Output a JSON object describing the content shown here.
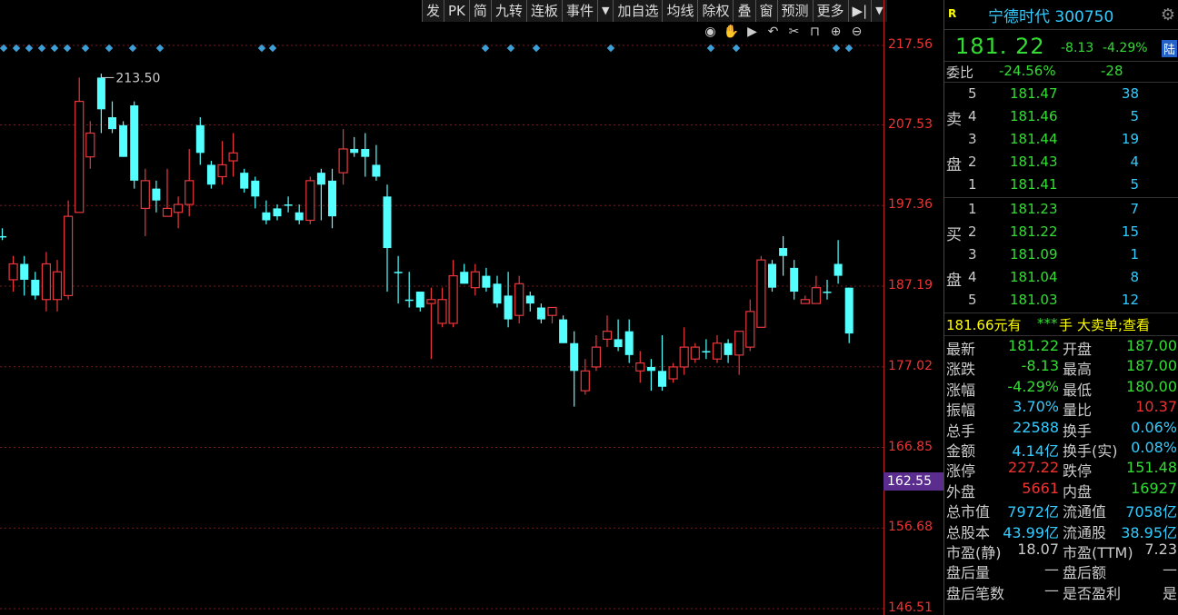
{
  "toolbar": {
    "items": [
      "发",
      "PK",
      "简",
      "九转",
      "连板",
      "事件",
      "▼",
      "加自选",
      "均线",
      "除权",
      "叠",
      "窗",
      "预测",
      "更多",
      "▶|",
      "▼"
    ]
  },
  "chart_controls": {
    "icons": [
      "eye-icon",
      "hand-icon",
      "play-icon",
      "undo-icon",
      "scissors-icon",
      "lock-icon",
      "zoom-in-icon",
      "zoom-out-icon"
    ]
  },
  "chart_data": {
    "type": "candlestick",
    "price_axis_labels": [
      "217.56",
      "207.53",
      "197.36",
      "187.19",
      "177.02",
      "166.85",
      "156.68",
      "146.51"
    ],
    "ylim": [
      146.51,
      222.0
    ],
    "current_price_tag": "162.55",
    "max_annotation": "213.50",
    "candles": [
      [
        193.5,
        193.5,
        194.5,
        193.0
      ],
      [
        188.0,
        190.0,
        191.0,
        186.5
      ],
      [
        190.0,
        188.0,
        191.0,
        186.0
      ],
      [
        188.0,
        186.0,
        189.0,
        185.5
      ],
      [
        185.5,
        190.0,
        191.5,
        184.0
      ],
      [
        185.5,
        189.0,
        190.5,
        184.0
      ],
      [
        186.0,
        196.0,
        198.0,
        185.5
      ],
      [
        196.5,
        210.5,
        213.5,
        202.0
      ],
      [
        203.5,
        206.5,
        208.0,
        202.0
      ],
      [
        213.5,
        209.5,
        214.0,
        206.5
      ],
      [
        208.5,
        207.0,
        210.5,
        206.5
      ],
      [
        207.5,
        203.5,
        208.0,
        203.5
      ],
      [
        210.0,
        200.5,
        210.5,
        199.5
      ],
      [
        197.0,
        200.5,
        202.0,
        193.5
      ],
      [
        199.5,
        198.0,
        200.5,
        196.5
      ],
      [
        196.0,
        197.0,
        202.0,
        196.0
      ],
      [
        196.5,
        197.5,
        198.5,
        194.5
      ],
      [
        197.5,
        200.5,
        204.5,
        196.0
      ],
      [
        207.5,
        204.0,
        208.5,
        202.5
      ],
      [
        202.5,
        200.0,
        203.0,
        199.5
      ],
      [
        201.0,
        202.5,
        205.5,
        200.0
      ],
      [
        203.0,
        204.0,
        206.5,
        201.0
      ],
      [
        201.5,
        199.5,
        202.0,
        199.0
      ],
      [
        200.5,
        198.5,
        201.0,
        197.0
      ],
      [
        196.5,
        195.5,
        198.0,
        195.0
      ],
      [
        197.0,
        196.0,
        197.5,
        195.5
      ],
      [
        197.5,
        197.5,
        198.5,
        196.5
      ],
      [
        196.5,
        195.5,
        197.5,
        195.0
      ],
      [
        195.5,
        200.5,
        201.0,
        195.0
      ],
      [
        201.5,
        200.0,
        202.0,
        195.5
      ],
      [
        200.5,
        196.0,
        202.0,
        194.5
      ],
      [
        201.5,
        204.5,
        207.0,
        200.0
      ],
      [
        204.5,
        204.0,
        206.0,
        203.5
      ],
      [
        204.5,
        203.5,
        206.5,
        201.0
      ],
      [
        202.5,
        201.0,
        205.0,
        200.5
      ],
      [
        198.5,
        192.0,
        200.0,
        186.5
      ],
      [
        189.0,
        189.0,
        191.0,
        185.0
      ],
      [
        185.5,
        185.5,
        189.0,
        184.5
      ],
      [
        186.5,
        184.5,
        186.5,
        184.0
      ],
      [
        185.0,
        185.5,
        187.0,
        178.0
      ],
      [
        182.5,
        185.5,
        187.0,
        182.0
      ],
      [
        182.5,
        188.5,
        190.5,
        182.0
      ],
      [
        189.0,
        187.5,
        190.0,
        187.5
      ],
      [
        187.0,
        189.0,
        190.0,
        186.0
      ],
      [
        188.5,
        187.0,
        189.5,
        186.5
      ],
      [
        187.5,
        185.0,
        188.5,
        184.5
      ],
      [
        186.0,
        183.0,
        189.0,
        182.0
      ],
      [
        183.5,
        187.5,
        188.5,
        182.5
      ],
      [
        186.0,
        185.0,
        186.5,
        184.0
      ],
      [
        184.5,
        183.0,
        185.0,
        182.5
      ],
      [
        183.5,
        184.5,
        184.5,
        182.5
      ],
      [
        183.0,
        180.0,
        183.5,
        180.0
      ],
      [
        180.0,
        176.5,
        181.5,
        172.0
      ],
      [
        174.0,
        176.5,
        178.0,
        173.5
      ],
      [
        177.0,
        179.5,
        181.0,
        176.5
      ],
      [
        180.5,
        181.5,
        183.5,
        179.5
      ],
      [
        180.5,
        179.5,
        183.0,
        179.0
      ],
      [
        181.5,
        178.5,
        183.0,
        177.5
      ],
      [
        176.5,
        177.5,
        179.0,
        175.0
      ],
      [
        177.0,
        176.5,
        178.0,
        174.0
      ],
      [
        176.5,
        174.5,
        181.0,
        174.0
      ],
      [
        175.5,
        177.0,
        177.5,
        175.0
      ],
      [
        177.0,
        179.5,
        182.0,
        176.0
      ],
      [
        178.0,
        179.5,
        180.0,
        177.5
      ],
      [
        179.0,
        179.0,
        180.5,
        178.0
      ],
      [
        178.0,
        180.0,
        181.0,
        177.5
      ],
      [
        180.0,
        178.5,
        180.5,
        177.5
      ],
      [
        178.5,
        181.5,
        181.5,
        176.0
      ],
      [
        179.5,
        184.0,
        185.5,
        179.0
      ],
      [
        182.0,
        190.5,
        191.0,
        182.0
      ],
      [
        190.0,
        187.0,
        190.5,
        186.5
      ],
      [
        192.0,
        191.0,
        193.5,
        188.5
      ],
      [
        189.5,
        186.5,
        190.5,
        185.5
      ],
      [
        185.0,
        185.5,
        186.0,
        185.0
      ],
      [
        185.0,
        187.0,
        188.5,
        185.0
      ],
      [
        186.5,
        186.5,
        188.0,
        185.5
      ],
      [
        190.0,
        188.5,
        193.0,
        187.5
      ],
      [
        187.0,
        181.22,
        187.0,
        180.0
      ]
    ],
    "markers_y": [
      217.56
    ]
  },
  "stock": {
    "badge": "R",
    "name": "宁德时代 300750",
    "last": "181. 22",
    "chg": "-8.13",
    "chgp": "-4.29%",
    "market": "陆"
  },
  "weibi": {
    "label": "委比",
    "pct": "-24.56%",
    "val": "-28"
  },
  "orderbook": {
    "sell_label": [
      "卖",
      "盘"
    ],
    "buy_label": [
      "买",
      "盘"
    ],
    "sell": [
      [
        "5",
        "181.47",
        "38"
      ],
      [
        "4",
        "181.46",
        "5"
      ],
      [
        "3",
        "181.44",
        "19"
      ],
      [
        "2",
        "181.43",
        "4"
      ],
      [
        "1",
        "181.41",
        "5"
      ]
    ],
    "buy": [
      [
        "1",
        "181.23",
        "7"
      ],
      [
        "2",
        "181.22",
        "15"
      ],
      [
        "3",
        "181.09",
        "1"
      ],
      [
        "4",
        "181.04",
        "8"
      ],
      [
        "5",
        "181.03",
        "12"
      ]
    ]
  },
  "bigorder": {
    "price": "181.66元有",
    "stars": "***",
    "hand": "手",
    "link": "大卖单;查看"
  },
  "stats": [
    {
      "l": "最新",
      "lv": "181.22",
      "lc": "g",
      "r": "开盘",
      "rv": "187.00",
      "rc": "g"
    },
    {
      "l": "涨跌",
      "lv": "-8.13",
      "lc": "g",
      "r": "最高",
      "rv": "187.00",
      "rc": "g"
    },
    {
      "l": "涨幅",
      "lv": "-4.29%",
      "lc": "g",
      "r": "最低",
      "rv": "180.00",
      "rc": "g"
    },
    {
      "l": "振幅",
      "lv": "3.70%",
      "lc": "c",
      "r": "量比",
      "rv": "10.37",
      "rc": "r"
    },
    {
      "l": "总手",
      "lv": "22588",
      "lc": "c",
      "r": "换手",
      "rv": "0.06%",
      "rc": "c"
    },
    {
      "l": "金额",
      "lv": "4.14亿",
      "lc": "c",
      "r": "换手(实)",
      "rv": "0.08%",
      "rc": "c"
    },
    {
      "l": "涨停",
      "lv": "227.22",
      "lc": "r",
      "r": "跌停",
      "rv": "151.48",
      "rc": "g"
    },
    {
      "l": "外盘",
      "lv": "5661",
      "lc": "r",
      "r": "内盘",
      "rv": "16927",
      "rc": "g"
    },
    {
      "l": "总市值",
      "lv": "7972亿",
      "lc": "c",
      "r": "流通值",
      "rv": "7058亿",
      "rc": "c"
    },
    {
      "l": "总股本",
      "lv": "43.99亿",
      "lc": "c",
      "r": "流通股",
      "rv": "38.95亿",
      "rc": "c"
    },
    {
      "l": "市盈(静)",
      "lv": "18.07",
      "lc": "w",
      "r": "市盈(TTM)",
      "rv": "7.23",
      "rc": "w"
    },
    {
      "l": "盘后量",
      "lv": "—",
      "lc": "w",
      "r": "盘后额",
      "rv": "—",
      "rc": "w"
    },
    {
      "l": "盘后笔数",
      "lv": "—",
      "lc": "w",
      "r": "是否盈利",
      "rv": "是",
      "rc": "w"
    }
  ],
  "colors": {
    "up": "#e8383d",
    "down": "#54ffff",
    "grid": "#7a1a1a",
    "marker": "#3d9fd6"
  }
}
